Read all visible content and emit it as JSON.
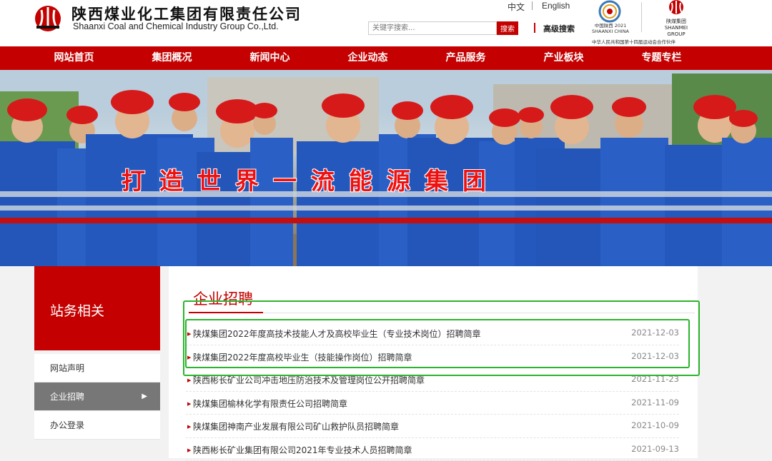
{
  "header": {
    "company_cn": "陕西煤业化工集团有限责任公司",
    "company_en": "Shaanxi Coal and Chemical Industry Group Co.,Ltd.",
    "lang_cn": "中文",
    "lang_en": "English",
    "search_placeholder": "关键字搜索...",
    "search_button": "搜索",
    "advanced_search": "高级搜索",
    "games_logo_text": "中国陕西 2021 SHAANXI CHINA",
    "games_caption": "中华人民共和国第十四届运动会合作伙伴",
    "group_logo_text": "陕煤集团 SHANMEI GROUP"
  },
  "nav": {
    "items": [
      "网站首页",
      "集团概况",
      "新闻中心",
      "企业动态",
      "产品服务",
      "产业板块",
      "专题专栏"
    ]
  },
  "banner": {
    "slogan": "打造世界一流能源集团"
  },
  "sidebar": {
    "title": "站务相关",
    "items": [
      {
        "label": "网站声明",
        "active": false
      },
      {
        "label": "企业招聘",
        "active": true
      },
      {
        "label": "办公登录",
        "active": false
      }
    ]
  },
  "main": {
    "title": "企业招聘",
    "news": [
      {
        "title": "陕煤集团2022年度高技术技能人才及高校毕业生（专业技术岗位）招聘简章",
        "date": "2021-12-03"
      },
      {
        "title": "陕煤集团2022年度高校毕业生（技能操作岗位）招聘简章",
        "date": "2021-12-03"
      },
      {
        "title": "陕西彬长矿业公司冲击地压防治技术及管理岗位公开招聘简章",
        "date": "2021-11-23"
      },
      {
        "title": "陕煤集团榆林化学有限责任公司招聘简章",
        "date": "2021-11-09"
      },
      {
        "title": "陕煤集团神南产业发展有限公司矿山救护队员招聘简章",
        "date": "2021-10-09"
      },
      {
        "title": "陕西彬长矿业集团有限公司2021年专业技术人员招聘简章",
        "date": "2021-09-13"
      }
    ]
  },
  "colors": {
    "brand_red": "#c40000",
    "highlight_green": "#2bb52b"
  }
}
